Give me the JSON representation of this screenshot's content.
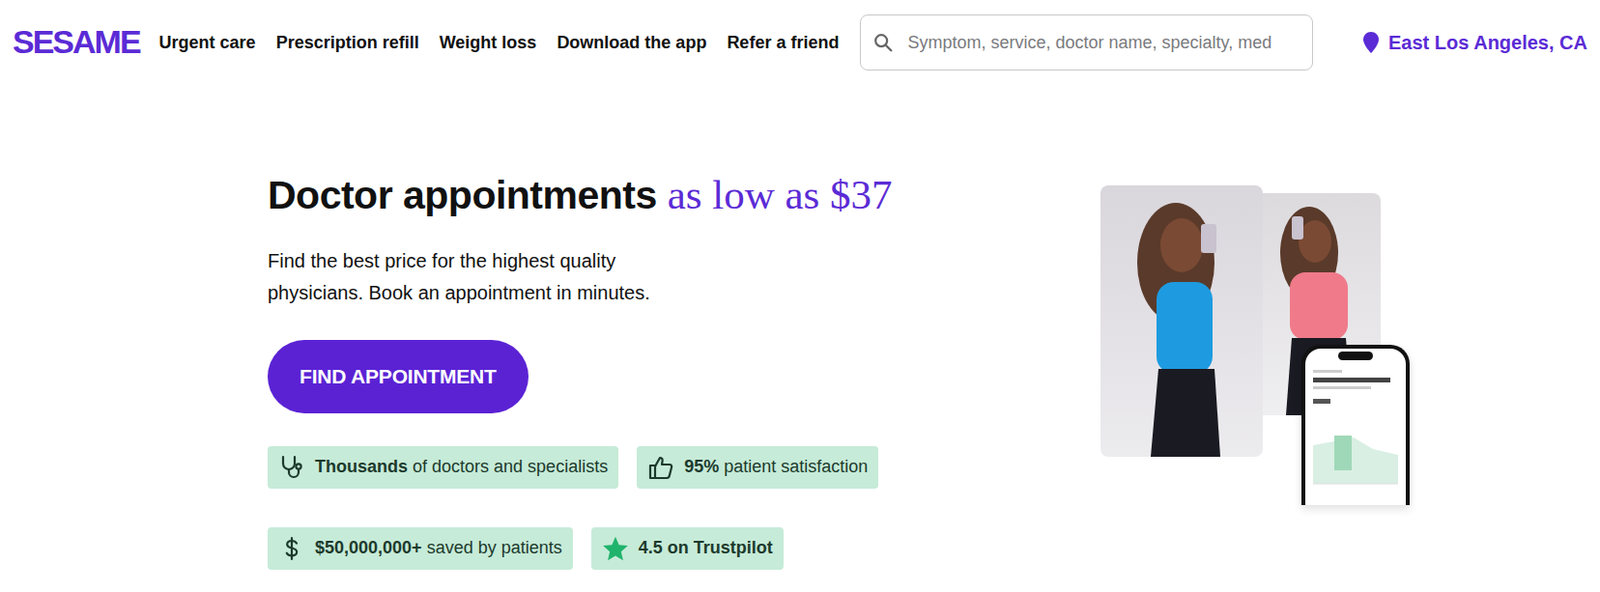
{
  "logo": "SESAME",
  "nav": [
    "Urgent care",
    "Prescription refill",
    "Weight loss",
    "Download the app",
    "Refer a friend"
  ],
  "search": {
    "placeholder": "Symptom, service, doctor name, specialty, med"
  },
  "location": "East Los Angeles, CA",
  "hero": {
    "title": "Doctor appointments",
    "title_accent": "as low as $37",
    "subtitle": "Find the best price for the highest quality physicians. Book an appointment in minutes.",
    "button": "FIND APPOINTMENT"
  },
  "badges": [
    {
      "strong": "Thousands",
      "text": "of doctors and specialists"
    },
    {
      "strong": "95%",
      "text": "patient satisfaction"
    },
    {
      "strong": "$50,000,000+",
      "text": "saved by patients"
    },
    {
      "strong": "4.5 on Trustpilot"
    }
  ]
}
